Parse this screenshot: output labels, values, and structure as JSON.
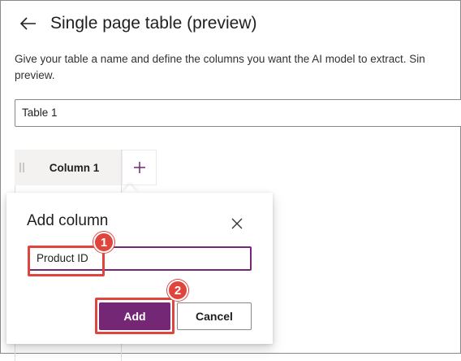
{
  "header": {
    "title": "Single page table (preview)",
    "description": "Give your table a name and define the columns you want the AI model to extract. Sin",
    "description_line2": "preview."
  },
  "table_name_field": {
    "value": "Table 1"
  },
  "columns": [
    {
      "label": "Column 1"
    }
  ],
  "add_column_dialog": {
    "title": "Add column",
    "name_value": "Product ID",
    "add_label": "Add",
    "cancel_label": "Cancel"
  },
  "annotations": [
    {
      "number": "1"
    },
    {
      "number": "2"
    }
  ],
  "colors": {
    "brand_purple": "#742774",
    "annotation_red": "#e0453d"
  },
  "icons": [
    "back-arrow-icon",
    "drag-handle-icon",
    "plus-icon",
    "close-icon"
  ]
}
